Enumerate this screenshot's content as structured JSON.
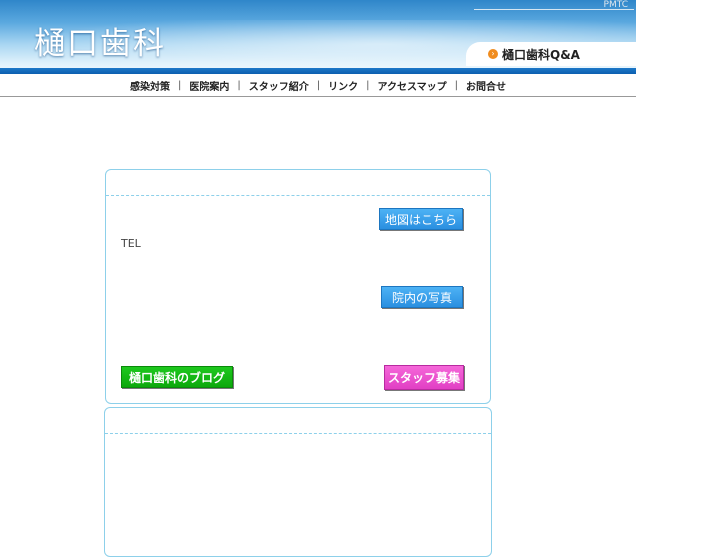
{
  "header": {
    "logo": "樋口歯科",
    "pmtc": "PMTC",
    "qa_link": "樋口歯科Q&A"
  },
  "nav": {
    "items": [
      "感染対策",
      "医院案内",
      "スタッフ紹介",
      "リンク",
      "アクセスマップ",
      "お問合せ"
    ],
    "separator": "|"
  },
  "info_box": {
    "map_button": "地図はこちら",
    "tel_label": "TEL",
    "photo_button": "院内の写真",
    "blog_button": "樋口歯科のブログ",
    "recruit_button": "スタッフ募集"
  },
  "colors": {
    "header_blue": "#2f86c9",
    "border": "#8dd0ea",
    "blue_button": "#2a8fe0",
    "green_button": "#0ca80c",
    "pink_button": "#e13fc4",
    "qa_icon": "#f08c1e"
  }
}
